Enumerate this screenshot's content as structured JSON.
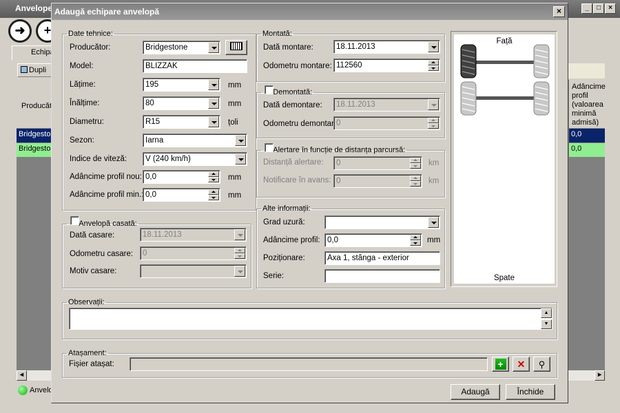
{
  "main_window": {
    "title": "Anvelope",
    "tab": "Echipa",
    "toolbar_button": "Dupli",
    "grid": {
      "left_header": "Producăt",
      "right_header": "Adâncime profil (valoarea minimă admisă)",
      "rows": [
        {
          "left": "Bridgestor",
          "right": "0,0"
        },
        {
          "left": "Bridgestor",
          "right": "0,0"
        }
      ]
    },
    "status": "Anvelo"
  },
  "dialog": {
    "title": "Adaugă echipare anvelopă",
    "tech": {
      "legend": "Date tehnice:",
      "producer_label": "Producător:",
      "producer_value": "Bridgestone",
      "model_label": "Model:",
      "model_value": "BLIZZAK",
      "width_label": "Lățime:",
      "width_value": "195",
      "width_unit": "mm",
      "height_label": "Înălțime:",
      "height_value": "80",
      "height_unit": "mm",
      "diameter_label": "Diametru:",
      "diameter_value": "R15",
      "diameter_unit": "țoli",
      "season_label": "Sezon:",
      "season_value": "Iarna",
      "speed_label": "Indice de viteză:",
      "speed_value": "V (240 km/h)",
      "new_depth_label": "Adâncime profil nou:",
      "new_depth_value": "0,0",
      "new_depth_unit": "mm",
      "min_depth_label": "Adâncime profil min.:",
      "min_depth_value": "0,0",
      "min_depth_unit": "mm"
    },
    "scrap": {
      "legend": "Anvelopă casată:",
      "date_label": "Dată casare:",
      "date_value": "18.11.2013",
      "odo_label": "Odometru casare:",
      "odo_value": "0",
      "reason_label": "Motiv casare:",
      "reason_value": ""
    },
    "mount": {
      "legend": "Montată:",
      "date_label": "Dată montare:",
      "date_value": "18.11.2013",
      "odo_label": "Odometru montare:",
      "odo_value": "112560"
    },
    "unmount": {
      "legend": "Demontată:",
      "date_label": "Dată demontare:",
      "date_value": "18.11.2013",
      "odo_label": "Odometru demontare:",
      "odo_value": "0"
    },
    "alert": {
      "legend": "Alertare în funcție de distanța parcursă:",
      "dist_label": "Distanță alertare:",
      "dist_value": "0",
      "dist_unit": "km",
      "notice_label": "Notificare în avans:",
      "notice_value": "0",
      "notice_unit": "km"
    },
    "other": {
      "legend": "Alte informații:",
      "wear_label": "Grad uzură:",
      "wear_value": "",
      "depth_label": "Adâncime profil:",
      "depth_value": "0,0",
      "depth_unit": "mm",
      "pos_label": "Poziționare:",
      "pos_value": "Axa 1, stânga - exterior",
      "serial_label": "Serie:",
      "serial_value": ""
    },
    "diagram": {
      "front": "Față",
      "back": "Spate"
    },
    "notes": {
      "legend": "Observații:",
      "value": ""
    },
    "attachment": {
      "legend": "Atașament:",
      "file_label": "Fișier atașat:",
      "file_value": ""
    },
    "add_button": "Adaugă",
    "close_button": "Închide"
  },
  "colors": {
    "row_selected": "#0a246a",
    "row_alt": "#90ee90",
    "tire_selected": "#404040",
    "tire_normal": "#c8c8c8"
  }
}
